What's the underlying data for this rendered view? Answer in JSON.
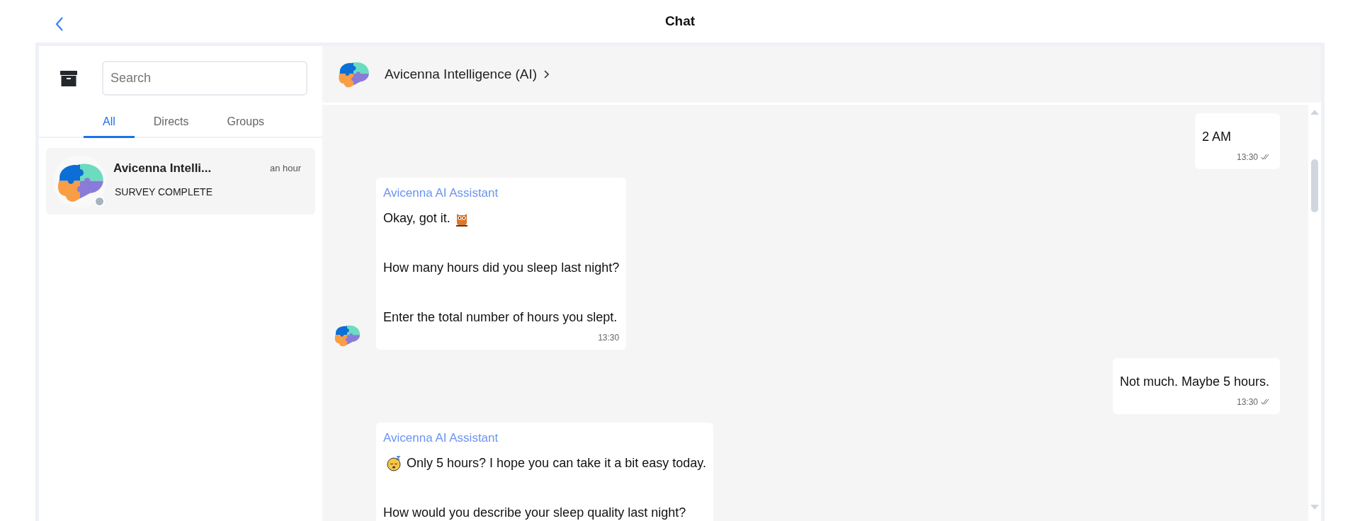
{
  "top_bar": {
    "title": "Chat"
  },
  "sidebar": {
    "search": {
      "placeholder": "Search"
    },
    "tabs": [
      {
        "label": "All",
        "selected": true
      },
      {
        "label": "Directs",
        "selected": false
      },
      {
        "label": "Groups",
        "selected": false
      }
    ],
    "conversations": [
      {
        "name": "Avicenna Intelli...",
        "time": "an hour",
        "preview": "SURVEY COMPLETE",
        "online": false
      }
    ]
  },
  "chat": {
    "header": {
      "name": "Avicenna Intelligence (AI)"
    },
    "messages": [
      {
        "kind": "outgoing",
        "lines": [
          {
            "text": "2 AM"
          }
        ],
        "time": "13:30",
        "read": true
      },
      {
        "kind": "incoming",
        "sender": "Avicenna AI Assistant",
        "lines": [
          {
            "text": "Okay, got it.",
            "kind": "emoji-after"
          },
          {
            "text": "How many hours did you sleep last night?"
          },
          {
            "text": "Enter the total number of hours you slept."
          }
        ],
        "time": "13:30",
        "avatar": true
      },
      {
        "kind": "outgoing",
        "lines": [
          {
            "text": "Not much. Maybe 5 hours."
          }
        ],
        "time": "13:30",
        "read": true
      },
      {
        "kind": "incoming",
        "sender": "Avicenna AI Assistant",
        "lines": [
          {
            "text": "Only 5 hours? I hope you can take it a bit easy today.",
            "kind": "emoji-before"
          },
          {
            "text": "How would you describe your sleep quality last night?"
          }
        ],
        "avatar": false
      }
    ]
  }
}
